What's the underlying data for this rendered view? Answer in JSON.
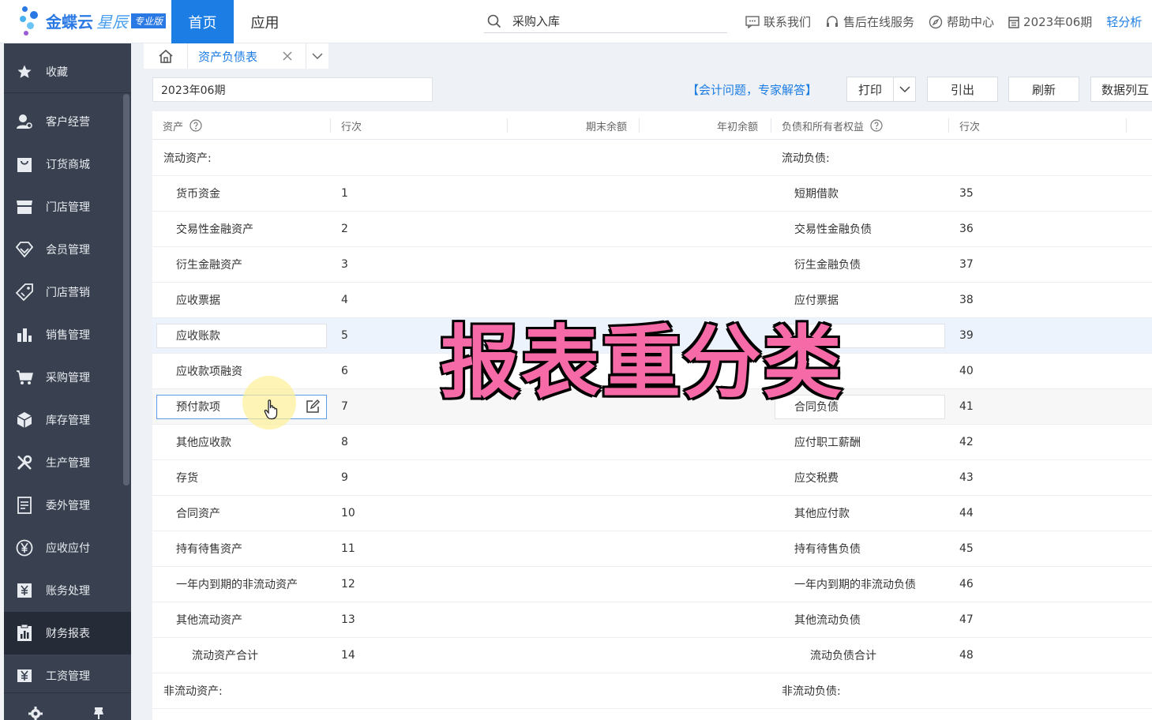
{
  "brand": {
    "name": "金蝶云",
    "sub": "星辰",
    "badge": "专业版",
    "colors": {
      "primary": "#1c7de4",
      "sidebar": "#394150",
      "overlay_text": "#f56aa7"
    }
  },
  "topnav": {
    "home": "首页",
    "apps": "应用",
    "search_value": "采购入库",
    "links": {
      "contact": "联系我们",
      "aftersale": "售后在线服务",
      "help": "帮助中心",
      "period": "2023年06期",
      "analysis": "轻分析"
    }
  },
  "sidebar": {
    "items": [
      {
        "label": "收藏",
        "icon": "star-icon"
      },
      {
        "label": "客户经营",
        "icon": "customer-icon"
      },
      {
        "label": "订货商城",
        "icon": "shop-bag-icon"
      },
      {
        "label": "门店管理",
        "icon": "store-icon"
      },
      {
        "label": "会员管理",
        "icon": "diamond-icon"
      },
      {
        "label": "门店营销",
        "icon": "tag-icon"
      },
      {
        "label": "销售管理",
        "icon": "bar-chart-icon"
      },
      {
        "label": "采购管理",
        "icon": "cart-icon"
      },
      {
        "label": "库存管理",
        "icon": "box-icon"
      },
      {
        "label": "生产管理",
        "icon": "tools-icon"
      },
      {
        "label": "委外管理",
        "icon": "document-icon"
      },
      {
        "label": "应收应付",
        "icon": "yen-circle-icon"
      },
      {
        "label": "账务处理",
        "icon": "ledger-icon"
      },
      {
        "label": "财务报表",
        "icon": "report-icon"
      },
      {
        "label": "工资管理",
        "icon": "salary-icon"
      }
    ],
    "active_index": 13
  },
  "tabs": {
    "active_label": "资产负债表"
  },
  "toolbar": {
    "period_value": "2023年06期",
    "advice": "【会计问题，专家解答】",
    "print": "打印",
    "export": "引出",
    "refresh": "刷新",
    "columns": "数据列互"
  },
  "table": {
    "headers": {
      "asset": "资产",
      "line_no": "行次",
      "end_balance": "期末余额",
      "begin_balance": "年初余额",
      "liability": "负债和所有者权益",
      "line_no_2": "行次"
    },
    "rows": [
      {
        "asset": "流动资产:",
        "a_no": "",
        "liab": "流动负债:",
        "l_no": "",
        "level": 0
      },
      {
        "asset": "货币资金",
        "a_no": "1",
        "liab": "短期借款",
        "l_no": "35",
        "level": 1
      },
      {
        "asset": "交易性金融资产",
        "a_no": "2",
        "liab": "交易性金融负债",
        "l_no": "36",
        "level": 1
      },
      {
        "asset": "衍生金融资产",
        "a_no": "3",
        "liab": "衍生金融负债",
        "l_no": "37",
        "level": 1
      },
      {
        "asset": "应收票据",
        "a_no": "4",
        "liab": "应付票据",
        "l_no": "38",
        "level": 1
      },
      {
        "asset": "应收账款",
        "a_no": "5",
        "liab": "",
        "l_no": "39",
        "level": 1
      },
      {
        "asset": "应收款项融资",
        "a_no": "6",
        "liab": "",
        "l_no": "40",
        "level": 1
      },
      {
        "asset": "预付款项",
        "a_no": "7",
        "liab": "合同负债",
        "l_no": "41",
        "level": 1
      },
      {
        "asset": "其他应收款",
        "a_no": "8",
        "liab": "应付职工薪酬",
        "l_no": "42",
        "level": 1
      },
      {
        "asset": "存货",
        "a_no": "9",
        "liab": "应交税费",
        "l_no": "43",
        "level": 1
      },
      {
        "asset": "合同资产",
        "a_no": "10",
        "liab": "其他应付款",
        "l_no": "44",
        "level": 1
      },
      {
        "asset": "持有待售资产",
        "a_no": "11",
        "liab": "持有待售负债",
        "l_no": "45",
        "level": 1
      },
      {
        "asset": "一年内到期的非流动资产",
        "a_no": "12",
        "liab": "一年内到期的非流动负债",
        "l_no": "46",
        "level": 1
      },
      {
        "asset": "其他流动资产",
        "a_no": "13",
        "liab": "其他流动负债",
        "l_no": "47",
        "level": 1
      },
      {
        "asset": "流动资产合计",
        "a_no": "14",
        "liab": "流动负债合计",
        "l_no": "48",
        "level": 2
      },
      {
        "asset": "非流动资产:",
        "a_no": "",
        "liab": "非流动负债:",
        "l_no": "",
        "level": 0
      }
    ]
  },
  "overlay": {
    "caption": "报表重分类"
  }
}
